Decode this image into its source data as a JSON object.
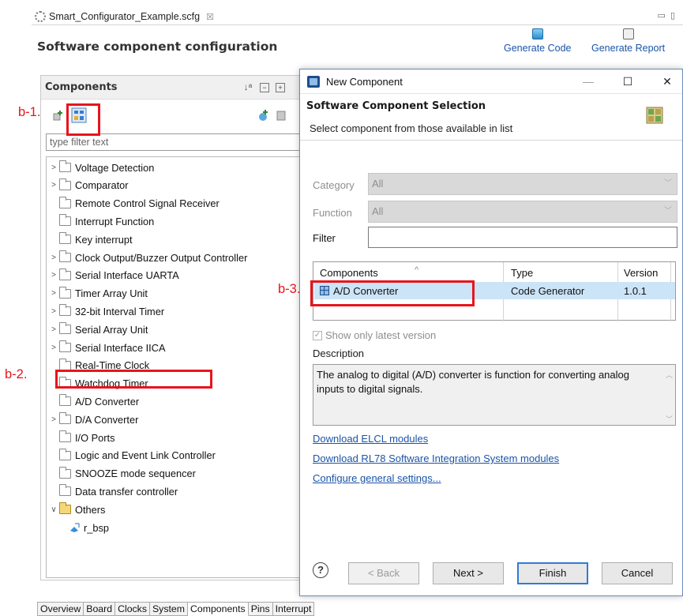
{
  "editor": {
    "tab_label": "Smart_Configurator_Example.scfg",
    "close_glyph": "☒",
    "title": "Software component configuration",
    "generate_code_label": "Generate Code",
    "generate_report_label": "Generate Report"
  },
  "components_panel": {
    "title": "Components",
    "filter_placeholder": "type filter text",
    "tree": [
      {
        "label": "Voltage Detection",
        "expandable": true
      },
      {
        "label": "Comparator",
        "expandable": true
      },
      {
        "label": "Remote Control Signal Receiver",
        "expandable": false
      },
      {
        "label": "Interrupt Function",
        "expandable": false
      },
      {
        "label": "Key interrupt",
        "expandable": false
      },
      {
        "label": "Clock Output/Buzzer Output Controller",
        "expandable": true
      },
      {
        "label": "Serial Interface UARTA",
        "expandable": true
      },
      {
        "label": "Timer Array Unit",
        "expandable": true
      },
      {
        "label": "32-bit Interval Timer",
        "expandable": true
      },
      {
        "label": "Serial Array Unit",
        "expandable": true
      },
      {
        "label": "Serial Interface  IICA",
        "expandable": true
      },
      {
        "label": "Real-Time Clock",
        "expandable": false
      },
      {
        "label": "Watchdog Timer",
        "expandable": false
      },
      {
        "label": "A/D Converter",
        "expandable": false,
        "selected": true
      },
      {
        "label": "D/A Converter",
        "expandable": true
      },
      {
        "label": "I/O Ports",
        "expandable": false
      },
      {
        "label": "Logic and Event Link Controller",
        "expandable": false
      },
      {
        "label": "SNOOZE mode sequencer",
        "expandable": false
      },
      {
        "label": "Data transfer controller",
        "expandable": false
      },
      {
        "label": "Others",
        "expandable": true,
        "expanded": true
      },
      {
        "label": "r_bsp",
        "child": true
      }
    ]
  },
  "bottom_tabs": [
    "Overview",
    "Board",
    "Clocks",
    "System",
    "Components",
    "Pins",
    "Interrupt"
  ],
  "active_bottom_tab": "Components",
  "dialog": {
    "title": "New Component",
    "heading": "Software Component Selection",
    "subheading": "Select component from those available in list",
    "category_label": "Category",
    "category_value": "All",
    "function_label": "Function",
    "function_value": "All",
    "filter_label": "Filter",
    "filter_value": "",
    "table": {
      "headers": [
        "Components",
        "Type",
        "Version"
      ],
      "rows": [
        {
          "component": "A/D Converter",
          "type": "Code Generator",
          "version": "1.0.1"
        }
      ]
    },
    "show_latest_label": "Show only latest version",
    "show_latest_checked": true,
    "description_label": "Description",
    "description_text": "The analog to digital (A/D) converter is function for converting analog inputs to digital signals.",
    "links": [
      "Download ELCL modules",
      "Download RL78 Software Integration System modules",
      "Configure general settings..."
    ],
    "buttons": {
      "help": "?",
      "back": "< Back",
      "next": "Next >",
      "finish": "Finish",
      "cancel": "Cancel"
    }
  },
  "annotations": [
    "b-1.",
    "b-2.",
    "b-3."
  ],
  "colors": {
    "annotation_red": "#e8141c",
    "selection_blue": "#cce4f7",
    "link_blue": "#1a54a8"
  }
}
